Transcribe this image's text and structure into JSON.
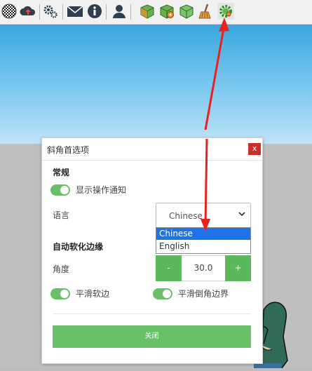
{
  "toolbar": {
    "icons": [
      "globe-icon",
      "cloud-upload-icon",
      "settings-gears-icon",
      "mail-icon",
      "info-icon",
      "user-icon",
      "extension-box-icon",
      "extension-box-gear-icon",
      "extension-shield-icon",
      "broom-icon",
      "gear-icon"
    ]
  },
  "dialog": {
    "title": "斜角首选项",
    "close_x": "x",
    "section_general": "常规",
    "show_notifications_label": "显示操作通知",
    "language_label": "语言",
    "language_selected": "Chinese",
    "language_options": [
      "Chinese",
      "English"
    ],
    "section_auto_soften": "自动软化边缘",
    "angle_label": "角度",
    "angle_minus": "-",
    "angle_value": "30.0",
    "angle_plus": "+",
    "smooth_soft_label": "平滑软边",
    "smooth_bevel_label": "平滑倒角边界",
    "close_button": "关闭",
    "toggles": {
      "show_notifications": true,
      "smooth_soft": true,
      "smooth_bevel": true
    }
  },
  "colors": {
    "accent_green": "#6abf69",
    "button_green": "#5cb85c",
    "close_red": "#c9302c",
    "selection_blue": "#1e73e8",
    "arrow_red": "#e8231e"
  }
}
